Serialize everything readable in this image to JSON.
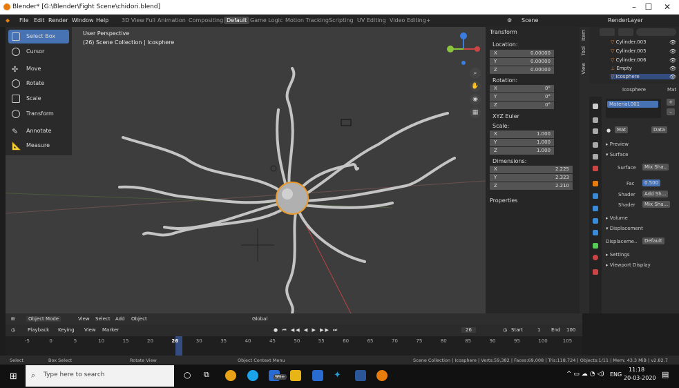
{
  "title_bar": {
    "title": "Blender* [G:\\Blender\\Fight Scene\\chidori.blend]",
    "minimize": "–",
    "maximize": "☐",
    "close": "✕"
  },
  "menu": {
    "items": [
      "File",
      "Edit",
      "Render",
      "Window",
      "Help"
    ],
    "workspaces": [
      "3D View Full",
      "Animation",
      "Compositing",
      "Default",
      "Game Logic",
      "Motion Tracking",
      "Scripting",
      "UV Editing",
      "Video Editing",
      "+"
    ],
    "active_workspace": "Default",
    "scene": "Scene",
    "render_layer": "RenderLayer"
  },
  "tools": [
    {
      "label": "Select Box",
      "icon": "select-box-icon",
      "active": true
    },
    {
      "label": "Cursor",
      "icon": "cursor-icon"
    },
    {
      "label": "Move",
      "icon": "move-icon"
    },
    {
      "label": "Rotate",
      "icon": "rotate-icon"
    },
    {
      "label": "Scale",
      "icon": "scale-icon"
    },
    {
      "label": "Transform",
      "icon": "transform-icon"
    },
    {
      "label": "Annotate",
      "icon": "annotate-icon"
    },
    {
      "label": "Measure",
      "icon": "measure-icon"
    }
  ],
  "viewport": {
    "perspective": "User Perspective",
    "collection": "(26) Scene Collection | Icosphere"
  },
  "transform": {
    "header": "Transform",
    "location_label": "Location:",
    "location": [
      {
        "axis": "X",
        "value": "0.00000"
      },
      {
        "axis": "Y",
        "value": "0.00000"
      },
      {
        "axis": "Z",
        "value": "0.00000"
      }
    ],
    "rotation_label": "Rotation:",
    "rotation": [
      {
        "axis": "X",
        "value": "0°"
      },
      {
        "axis": "Y",
        "value": "0°"
      },
      {
        "axis": "Z",
        "value": "0°"
      }
    ],
    "rotation_mode": "XYZ Euler",
    "scale_label": "Scale:",
    "scale": [
      {
        "axis": "X",
        "value": "1.000"
      },
      {
        "axis": "Y",
        "value": "1.000"
      },
      {
        "axis": "Z",
        "value": "1.000"
      }
    ],
    "dimensions_label": "Dimensions:",
    "dimensions": [
      {
        "axis": "X",
        "value": "2.225"
      },
      {
        "axis": "Y",
        "value": "2.323"
      },
      {
        "axis": "Z",
        "value": "2.210"
      }
    ],
    "properties": "Properties"
  },
  "side_tabs": [
    "Item",
    "Tool",
    "View"
  ],
  "outliner": {
    "items": [
      "Cylinder.003",
      "Cylinder.005",
      "Cylinder.006",
      "Empty",
      "Icosphere"
    ],
    "selected": "Icosphere"
  },
  "properties_editor": {
    "object": "Icosphere",
    "mat_tab": "Mat",
    "material_slot": "Material.001",
    "mat_short": "Mat",
    "data": "Data",
    "preview": "Preview",
    "surface": "Surface",
    "surface_label": "Surface",
    "surface_value": "Mix Sha..",
    "fac_label": "Fac",
    "fac_value": "0.500",
    "shader1_label": "Shader",
    "shader1_value": "Add Sh...",
    "shader2_label": "Shader",
    "shader2_value": "Mix Sha...",
    "volume": "Volume",
    "displacement": "Displacement",
    "displacement_label": "Displaceme..",
    "displacement_value": "Default",
    "settings": "Settings",
    "viewport_display": "Viewport Display"
  },
  "viewport_header": {
    "mode": "Object Mode",
    "view": "View",
    "select": "Select",
    "add": "Add",
    "object": "Object",
    "orientation": "Global"
  },
  "timeline": {
    "playback": "Playback",
    "keying": "Keying",
    "view": "View",
    "marker": "Marker",
    "current_frame": "26",
    "start_label": "Start",
    "start": "1",
    "end_label": "End",
    "end": "100",
    "ticks": [
      "-5",
      "0",
      "5",
      "10",
      "15",
      "20",
      "26",
      "30",
      "35",
      "40",
      "45",
      "50",
      "55",
      "60",
      "65",
      "70",
      "75",
      "80",
      "85",
      "90",
      "95",
      "100",
      "105"
    ]
  },
  "status_bar": {
    "select": "Select",
    "box_select": "Box Select",
    "rotate_view": "Rotate View",
    "context_menu": "Object Context Menu",
    "stats": "Scene Collection | Icosphere | Verts:59,382 | Faces:69,008 | Tris:118,724 | Objects:1/11 | Mem: 43.3 MiB | v2.82.7"
  },
  "taskbar": {
    "search_placeholder": "Type here to search",
    "badge": "99+",
    "lang": "ENG",
    "time": "11:18",
    "date": "20-03-2020"
  }
}
